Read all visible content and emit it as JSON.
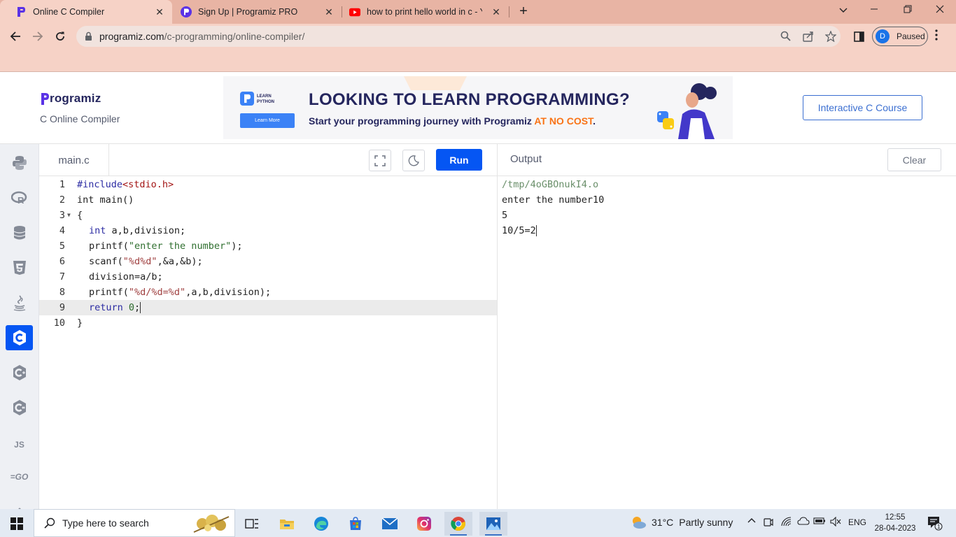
{
  "browser": {
    "tabs": [
      {
        "title": "Online C Compiler",
        "active": true
      },
      {
        "title": "Sign Up | Programiz PRO",
        "active": false
      },
      {
        "title": "how to print hello world in c - Yo",
        "active": false
      }
    ],
    "url_domain": "programiz.com",
    "url_path": "/c-programming/online-compiler/",
    "profile_initial": "D",
    "profile_status": "Paused"
  },
  "header": {
    "logo_text": "rogramiz",
    "subtitle": "C Online Compiler",
    "banner": {
      "badge_text": "LEARN PYTHON",
      "learn_more": "Learn More",
      "headline": "LOOKING TO LEARN PROGRAMMING?",
      "tagline_prefix": "Start your programming journey with Programiz ",
      "tagline_highlight": "AT NO COST",
      "tagline_suffix": "."
    },
    "course_button": "Interactive C Course"
  },
  "sidebar": {
    "languages": [
      {
        "name": "python-icon",
        "label": ""
      },
      {
        "name": "r-icon",
        "label": ""
      },
      {
        "name": "sql-icon",
        "label": ""
      },
      {
        "name": "html5-icon",
        "label": ""
      },
      {
        "name": "java-icon",
        "label": ""
      },
      {
        "name": "c-icon",
        "label": "",
        "active": true
      },
      {
        "name": "cpp-icon",
        "label": ""
      },
      {
        "name": "csharp-icon",
        "label": ""
      },
      {
        "name": "javascript-icon",
        "label": "JS"
      },
      {
        "name": "go-icon",
        "label": "GO"
      }
    ]
  },
  "editor": {
    "file_name": "main.c",
    "run_label": "Run",
    "lines": [
      {
        "n": "1"
      },
      {
        "n": "2"
      },
      {
        "n": "3"
      },
      {
        "n": "4"
      },
      {
        "n": "5"
      },
      {
        "n": "6"
      },
      {
        "n": "7"
      },
      {
        "n": "8"
      },
      {
        "n": "9"
      },
      {
        "n": "10"
      }
    ],
    "code": {
      "l1_pp": "#include",
      "l1_inc": "<stdio.h>",
      "l2": "int main()",
      "l3": "{",
      "l4_kw": "int",
      "l4_rest": " a,b,division;",
      "l5_fn": "printf(",
      "l5_str": "\"enter the number\"",
      "l5_end": ");",
      "l6_fn": "scanf(",
      "l6_str": "\"%d%d\"",
      "l6_end": ",&a,&b);",
      "l7": "division=a/b;",
      "l8_fn": "printf(",
      "l8_str": "\"%d/%d=%d\"",
      "l8_end": ",a,b,division);",
      "l9_kw": "return",
      "l9_num": " 0",
      "l9_end": ";",
      "l10": "}"
    }
  },
  "output": {
    "title": "Output",
    "clear_label": "Clear",
    "lines": [
      "/tmp/4oGBOnukI4.o",
      "enter the number10",
      "5",
      "10/5=2"
    ]
  },
  "taskbar": {
    "search_placeholder": "Type here to search",
    "weather_temp": "31°C",
    "weather_desc": "Partly sunny",
    "language": "ENG",
    "time": "12:55",
    "date": "28-04-2023",
    "notification_count": "1"
  }
}
